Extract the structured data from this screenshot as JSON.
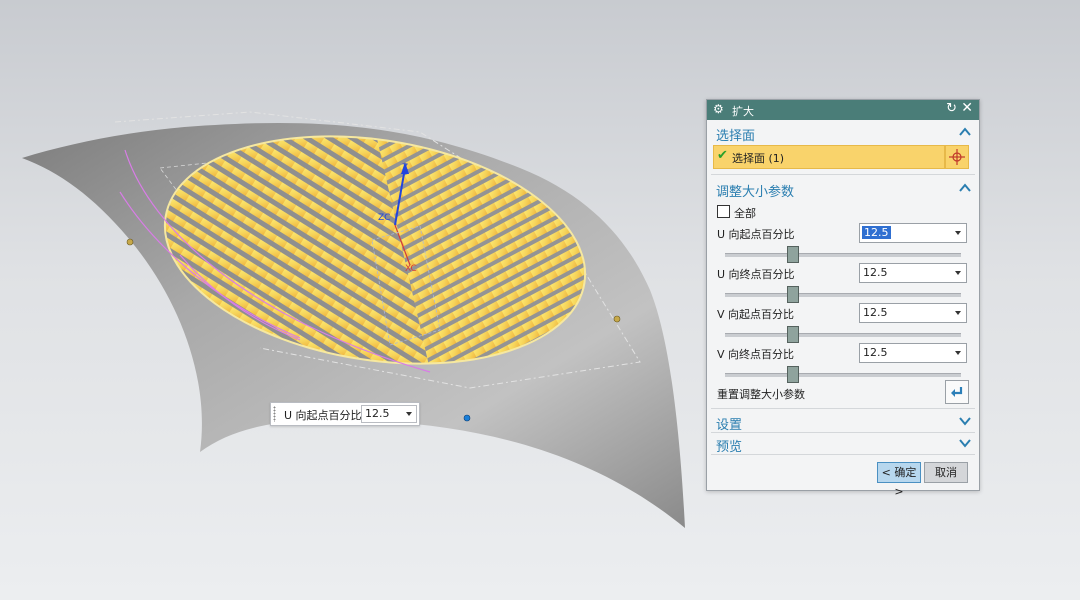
{
  "viewport": {
    "axis_label_z": "Z",
    "axis_label_zc": "ZC",
    "axis_label_xc": "XC",
    "colors": {
      "surface": "#9c9c9c",
      "face": "#f3d35c",
      "curve": "#d87de6"
    },
    "onscreen_input": {
      "label": "U 向起点百分比",
      "value": "12.5"
    }
  },
  "dialog": {
    "title": "扩大",
    "sections": {
      "select_face": {
        "header": "选择面",
        "item_label": "选择面 (1)"
      },
      "resize_params": {
        "header": "调整大小参数",
        "all_label": "全部",
        "rows": [
          {
            "label": "U 向起点百分比",
            "value": "12.5",
            "level": 12.5
          },
          {
            "label": "U 向终点百分比",
            "value": "12.5",
            "level": 12.5
          },
          {
            "label": "V 向起点百分比",
            "value": "12.5",
            "level": 12.5
          },
          {
            "label": "V 向终点百分比",
            "value": "12.5",
            "level": 12.5
          }
        ],
        "reset_label": "重置调整大小参数"
      },
      "settings": {
        "header": "设置"
      },
      "preview": {
        "header": "预览"
      }
    },
    "ok_label": "< 确定 >",
    "cancel_label": "取消"
  }
}
